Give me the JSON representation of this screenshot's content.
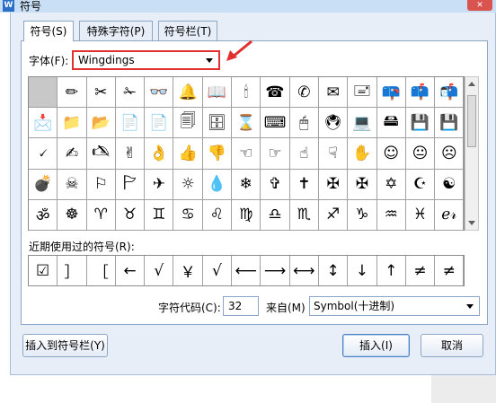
{
  "window": {
    "title": "符号",
    "app_icon": "W"
  },
  "tabs": [
    {
      "label": "符号(S)"
    },
    {
      "label": "特殊字符(P)"
    },
    {
      "label": "符号栏(T)"
    }
  ],
  "font": {
    "label": "字体(F):",
    "value": "Wingdings"
  },
  "symbols": [
    " ",
    "✏",
    "✂",
    "✁",
    "👓",
    "🔔",
    "📖",
    "🕯",
    "☎",
    "✆",
    "✉",
    "🖃",
    "📪",
    "📫",
    "📬",
    "📩",
    "📁",
    "📂",
    "📄",
    "📄",
    "🗐",
    "🗄",
    "⌛",
    "⌨",
    "🖱",
    "🖲",
    "💻",
    "🖴",
    "💾",
    "💾",
    "🗸",
    "✍",
    "🖎",
    "✌",
    "👌",
    "👍",
    "👎",
    "☜",
    "☞",
    "☝",
    "☟",
    "✋",
    "☺",
    "😐",
    "☹",
    "💣",
    "☠",
    "⚐",
    "🏱",
    "✈",
    "☼",
    "💧",
    "❄",
    "✞",
    "✝",
    "✠",
    "✠",
    "✡",
    "☪",
    "☯",
    "ॐ",
    "☸",
    "♈",
    "♉",
    "♊",
    "♋",
    "♌",
    "♍",
    "♎",
    "♏",
    "♐",
    "♑",
    "♒",
    "♓",
    "ℯ𝓇"
  ],
  "recent": {
    "label": "近期使用过的符号(R):",
    "items": [
      "☑",
      "］",
      "［",
      "←",
      "√",
      "￥",
      "√",
      "⟵",
      "⟶",
      "⟷",
      "↕",
      "↓",
      "↑",
      "≠",
      "≠"
    ]
  },
  "char_code": {
    "label": "字符代码(C):",
    "value": "32"
  },
  "from": {
    "label": "来自(M)",
    "value": "Symbol(十进制)"
  },
  "buttons": {
    "insert_to_bar": "插入到符号栏(Y)",
    "insert": "插入(I)",
    "cancel": "取消"
  },
  "colors": {
    "highlight": "#e03030",
    "accent": "#2b6fc9"
  }
}
